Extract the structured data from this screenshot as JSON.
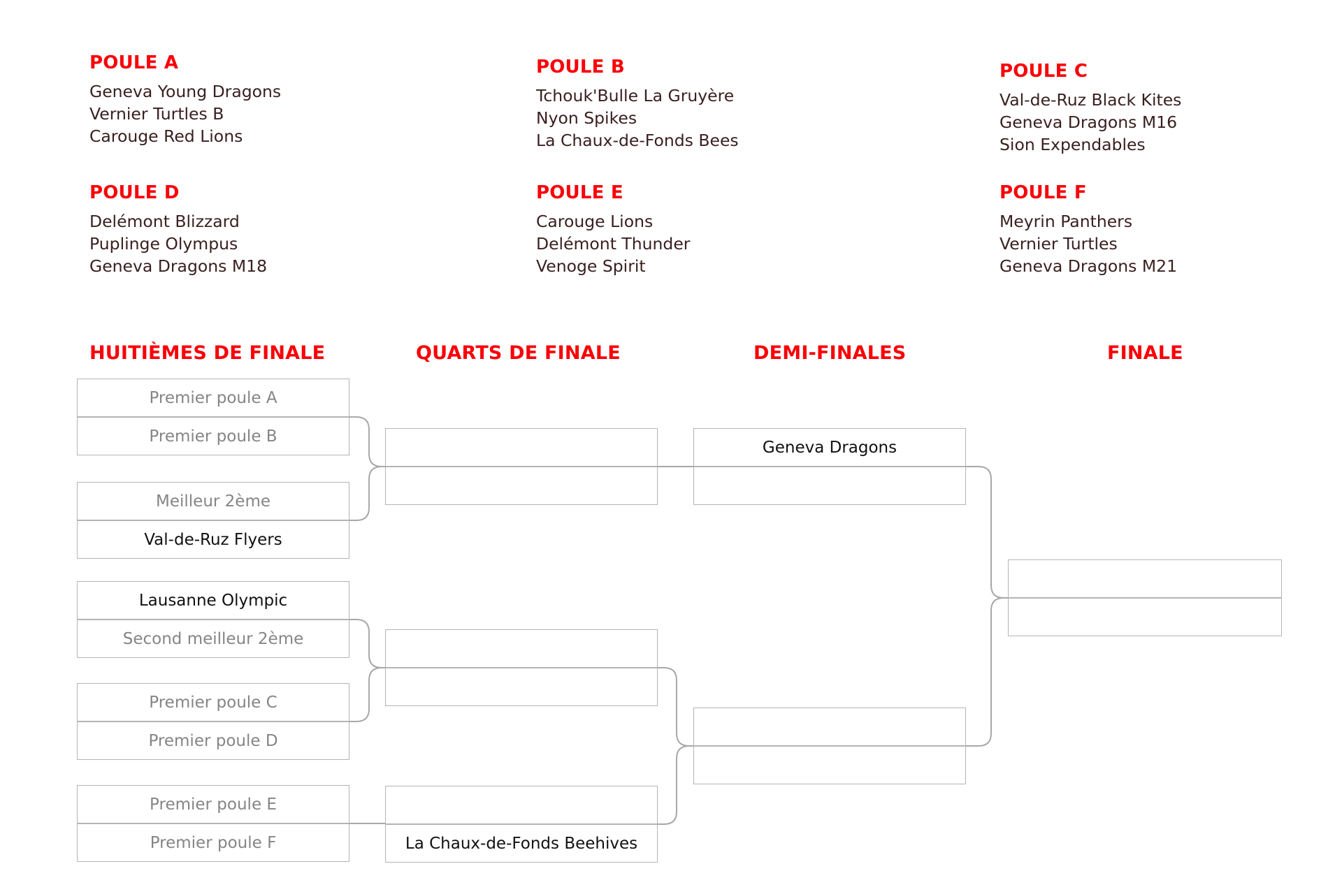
{
  "colors": {
    "accent_red": "#fb0007",
    "placeholder_gray": "#858585",
    "text_dark": "#3a2020",
    "box_border": "#b4b4b4",
    "connector": "#a8a8a8"
  },
  "pools": [
    {
      "title": "POULE A",
      "teams": [
        "Geneva Young Dragons",
        "Vernier Turtles B",
        "Carouge Red Lions"
      ]
    },
    {
      "title": "POULE B",
      "teams": [
        "Tchouk'Bulle La Gruyère",
        "Nyon Spikes",
        "La Chaux-de-Fonds Bees"
      ]
    },
    {
      "title": "POULE C",
      "teams": [
        "Val-de-Ruz Black Kites",
        "Geneva Dragons M16",
        "Sion Expendables"
      ]
    },
    {
      "title": "POULE D",
      "teams": [
        "Delémont Blizzard",
        "Puplinge Olympus",
        "Geneva Dragons M18"
      ]
    },
    {
      "title": "POULE E",
      "teams": [
        "Carouge Lions",
        "Delémont Thunder",
        "Venoge Spirit"
      ]
    },
    {
      "title": "POULE F",
      "teams": [
        "Meyrin Panthers",
        "Vernier Turtles",
        "Geneva Dragons M21"
      ]
    }
  ],
  "bracket": {
    "round_titles": [
      "HUITIÈMES DE FINALE",
      "QUARTS DE FINALE",
      "DEMI-FINALES",
      "FINALE"
    ],
    "round_of_16": [
      {
        "top": "Premier poule A",
        "top_state": "placeholder",
        "bottom": "Premier poule B",
        "bottom_state": "placeholder"
      },
      {
        "top": "Meilleur 2ème",
        "top_state": "placeholder",
        "bottom": "Val-de-Ruz Flyers",
        "bottom_state": "filled"
      },
      {
        "top": "Lausanne Olympic",
        "top_state": "filled",
        "bottom": "Second meilleur 2ème",
        "bottom_state": "placeholder"
      },
      {
        "top": "Premier poule C",
        "top_state": "placeholder",
        "bottom": "Premier poule D",
        "bottom_state": "placeholder"
      },
      {
        "top": "Premier poule E",
        "top_state": "placeholder",
        "bottom": "Premier poule F",
        "bottom_state": "placeholder"
      }
    ],
    "quarter_finals": [
      {
        "top": "",
        "top_state": "empty",
        "bottom": "",
        "bottom_state": "empty"
      },
      {
        "top": "",
        "top_state": "empty",
        "bottom": "",
        "bottom_state": "empty"
      },
      {
        "top": "",
        "top_state": "empty",
        "bottom": "La Chaux-de-Fonds Beehives",
        "bottom_state": "filled"
      }
    ],
    "semi_finals": [
      {
        "top": "Geneva Dragons",
        "top_state": "filled",
        "bottom": "",
        "bottom_state": "empty"
      },
      {
        "top": "",
        "top_state": "empty",
        "bottom": "",
        "bottom_state": "empty"
      }
    ],
    "final": [
      {
        "top": "",
        "top_state": "empty",
        "bottom": "",
        "bottom_state": "empty"
      }
    ]
  }
}
